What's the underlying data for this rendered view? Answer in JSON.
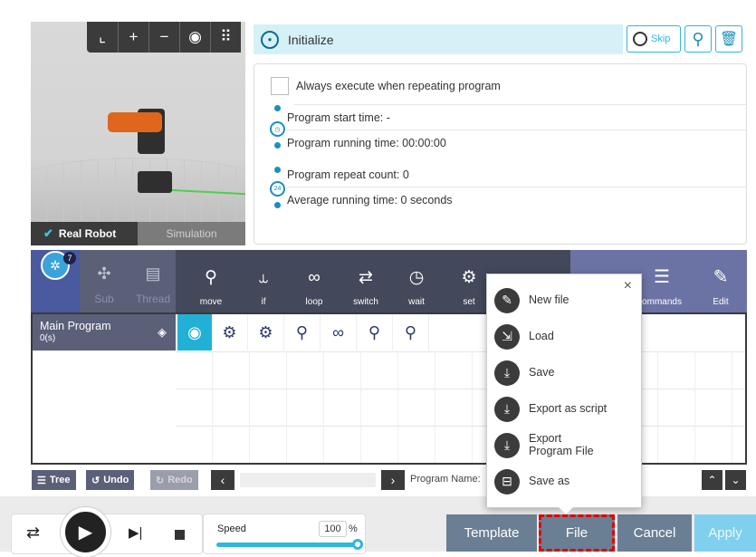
{
  "view3d": {
    "toolbar_icons": [
      "axis-icon",
      "zoom-in-icon",
      "zoom-out-icon",
      "eye-icon",
      "grid-icon"
    ],
    "toolbar_glyphs": [
      "⌞",
      "+",
      "−",
      "◉",
      "⠿"
    ],
    "real_robot_label": "Real Robot",
    "simulation_label": "Simulation"
  },
  "header": {
    "title": "Initialize",
    "skip_label": "Skip"
  },
  "info": {
    "always_execute": "Always execute when repeating program",
    "start_time": "Program start time: -",
    "running_time": "Program running time: 00:00:00",
    "repeat_count": "Program repeat count: 0",
    "average_time": "Average running time: 0 seconds"
  },
  "left_tabs": {
    "badge": "7",
    "sub": "Sub",
    "thread": "Thread"
  },
  "commands": [
    {
      "label": "move",
      "glyph": "⚲"
    },
    {
      "label": "if",
      "glyph": "⥿"
    },
    {
      "label": "loop",
      "glyph": "∞"
    },
    {
      "label": "switch",
      "glyph": "⇄"
    },
    {
      "label": "wait",
      "glyph": "◷"
    },
    {
      "label": "set",
      "glyph": "⚙"
    },
    {
      "label": "",
      "glyph": "▭"
    }
  ],
  "right_tabs": {
    "commands_label": "ommands",
    "edit_label": "Edit"
  },
  "program": {
    "main_label": "Main Program",
    "main_sub": "0(s)",
    "cells": [
      "⚙",
      "⚙",
      "⚲",
      "∞",
      "⚲",
      "⚲"
    ]
  },
  "bottom_toolbar": {
    "tree": "Tree",
    "undo": "Undo",
    "redo": "Redo",
    "program_name": "Program Name:"
  },
  "footer": {
    "speed_label": "Speed",
    "speed_value": "100",
    "speed_unit": "%",
    "speed_fraction": 1.0,
    "template": "Template",
    "file": "File",
    "cancel": "Cancel",
    "apply": "Apply"
  },
  "popup": {
    "close": "×",
    "items": [
      {
        "label": "New file",
        "icon": "new-file-icon",
        "glyph": "✎"
      },
      {
        "label": "Load",
        "icon": "load-icon",
        "glyph": "⇲"
      },
      {
        "label": "Save",
        "icon": "save-icon",
        "glyph": "⤓"
      },
      {
        "label": "Export as script",
        "icon": "export-script-icon",
        "glyph": "⤓"
      },
      {
        "label": "Export Program File",
        "icon": "export-program-icon",
        "glyph": "⤓"
      },
      {
        "label": "Save as",
        "icon": "save-as-icon",
        "glyph": "⊟"
      }
    ]
  },
  "colors": {
    "accent": "#32b5de",
    "nav": "#43485a",
    "file_highlight": "#e00000"
  }
}
